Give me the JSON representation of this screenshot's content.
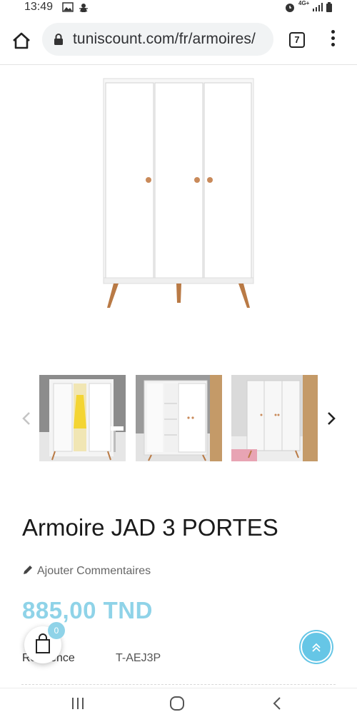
{
  "status_bar": {
    "time": "13:49",
    "network": "4G+"
  },
  "browser": {
    "url": "tuniscount.com/fr/armoires/",
    "tab_count": "7"
  },
  "gallery": {
    "main_image": "wardrobe-white-3-doors",
    "thumbnails": [
      "wardrobe-open-yellow-dress",
      "wardrobe-open-shelves",
      "wardrobe-closed-room"
    ]
  },
  "product": {
    "title": "Armoire JAD 3 PORTES",
    "comment_link": "Ajouter Commentaires",
    "price": "885,00 TND",
    "reference_label": "Reference",
    "reference_value": "T-AEJ3P"
  },
  "cart": {
    "count": "0"
  },
  "colors": {
    "accent": "#8fd3e8",
    "scroll_top": "#66c6e6"
  }
}
